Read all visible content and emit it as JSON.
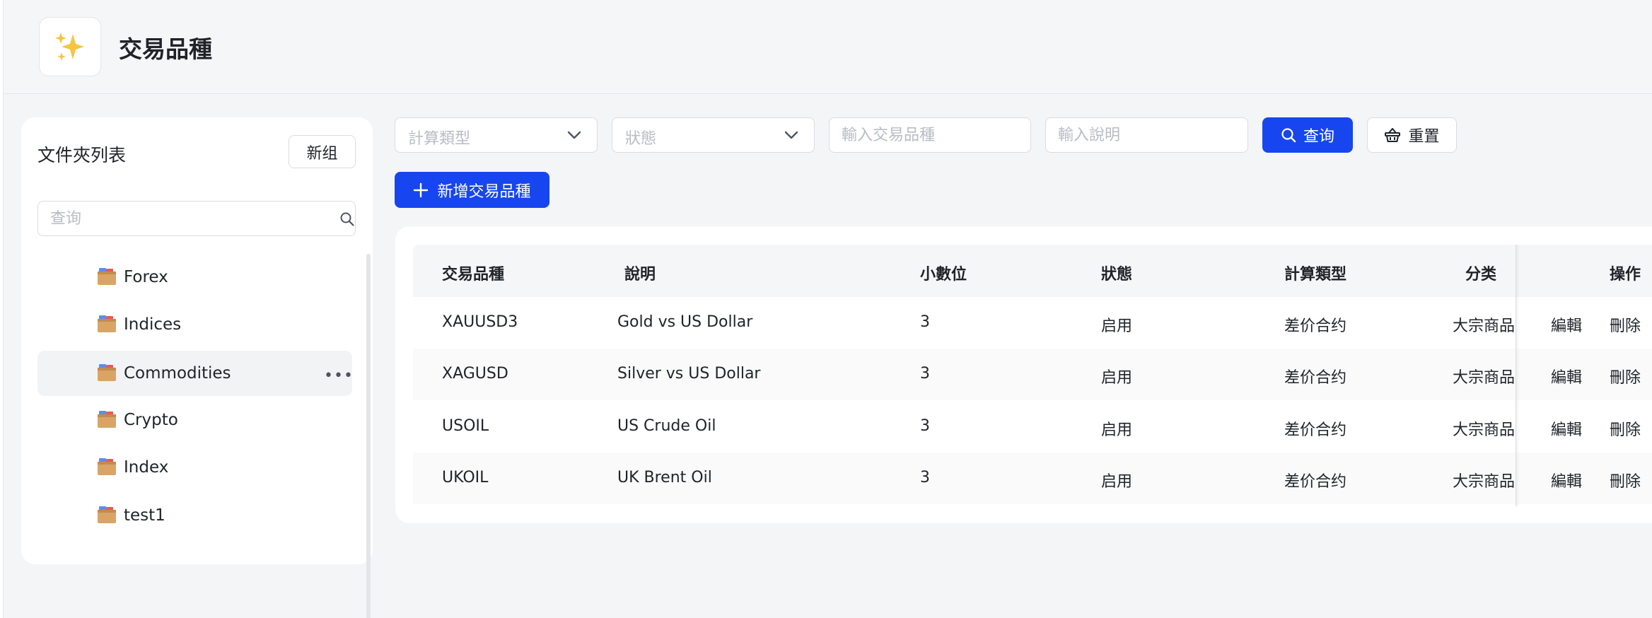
{
  "header": {
    "title": "交易品種",
    "logo_icon": "sparkles-icon"
  },
  "folder_panel": {
    "title": "文件夾列表",
    "new_group_label": "新组",
    "search_placeholder": "查询",
    "items": [
      {
        "label": "Forex",
        "active": false
      },
      {
        "label": "Indices",
        "active": false
      },
      {
        "label": "Commodities",
        "active": true
      },
      {
        "label": "Crypto",
        "active": false
      },
      {
        "label": "Index",
        "active": false
      },
      {
        "label": "test1",
        "active": false
      }
    ]
  },
  "filters": {
    "calc_type_placeholder": "計算類型",
    "status_placeholder": "狀態",
    "symbol_placeholder": "輸入交易品種",
    "desc_placeholder": "輸入說明",
    "query_label": "查询",
    "reset_label": "重置",
    "add_label": "新增交易品種"
  },
  "table": {
    "columns": [
      "交易品種",
      "說明",
      "小數位",
      "狀態",
      "計算類型",
      "分类",
      "操作"
    ],
    "rows": [
      {
        "symbol": "XAUUSD3",
        "description": "Gold vs US Dollar",
        "digits": "3",
        "status": "启用",
        "calc_type": "差价合约",
        "category": "大宗商品",
        "edit": "編輯",
        "delete": "刪除"
      },
      {
        "symbol": "XAGUSD",
        "description": "Silver vs US Dollar",
        "digits": "3",
        "status": "启用",
        "calc_type": "差价合约",
        "category": "大宗商品",
        "edit": "編輯",
        "delete": "刪除"
      },
      {
        "symbol": "USOIL",
        "description": "US Crude Oil",
        "digits": "3",
        "status": "启用",
        "calc_type": "差价合约",
        "category": "大宗商品",
        "edit": "編輯",
        "delete": "刪除"
      },
      {
        "symbol": "UKOIL",
        "description": "UK Brent Oil",
        "digits": "3",
        "status": "启用",
        "calc_type": "差价合约",
        "category": "大宗商品",
        "edit": "編輯",
        "delete": "刪除"
      }
    ]
  },
  "colors": {
    "primary": "#1746f0",
    "page_bg": "#f4f5f7",
    "logo_star": "#f5c542"
  }
}
